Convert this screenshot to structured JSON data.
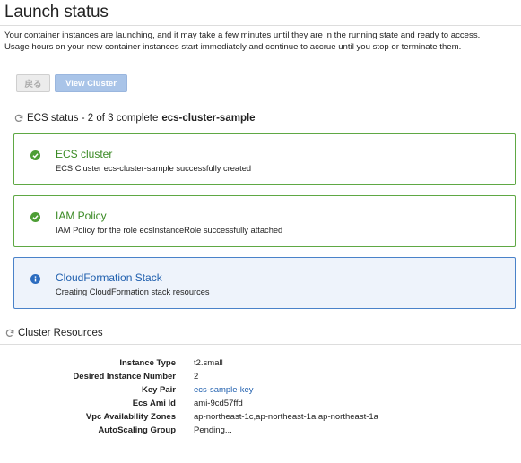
{
  "title": "Launch status",
  "intro": {
    "line1": "Your container instances are launching, and it may take a few minutes until they are in the running state and ready to access.",
    "line2": "Usage hours on your new container instances start immediately and continue to accrue until you stop or terminate them."
  },
  "buttons": {
    "back": "戻る",
    "view_cluster": "View Cluster"
  },
  "ecs_status": {
    "prefix": "ECS status - 2 of 3 complete",
    "cluster_name": "ecs-cluster-sample"
  },
  "cards": [
    {
      "state": "success",
      "icon": "check-circle-icon",
      "title": "ECS cluster",
      "description": "ECS Cluster ecs-cluster-sample successfully created"
    },
    {
      "state": "success",
      "icon": "check-circle-icon",
      "title": "IAM Policy",
      "description": "IAM Policy for the role ecsInstanceRole successfully attached"
    },
    {
      "state": "in-progress",
      "icon": "info-circle-icon",
      "title": "CloudFormation Stack",
      "description": "Creating CloudFormation stack resources"
    }
  ],
  "cluster_resources": {
    "heading": "Cluster Resources",
    "rows": [
      {
        "label": "Instance Type",
        "value": "t2.small"
      },
      {
        "label": "Desired Instance Number",
        "value": "2"
      },
      {
        "label": "Key Pair",
        "value": "ecs-sample-key"
      },
      {
        "label": "Ecs Ami Id",
        "value": "ami-9cd57ffd"
      },
      {
        "label": "Vpc Availability Zones",
        "value": "ap-northeast-1c,ap-northeast-1a,ap-northeast-1a"
      },
      {
        "label": "AutoScaling Group",
        "value": "Pending..."
      }
    ]
  },
  "colors": {
    "success": "#3a8a24",
    "info": "#1f5fae",
    "link": "#1f5fae"
  }
}
